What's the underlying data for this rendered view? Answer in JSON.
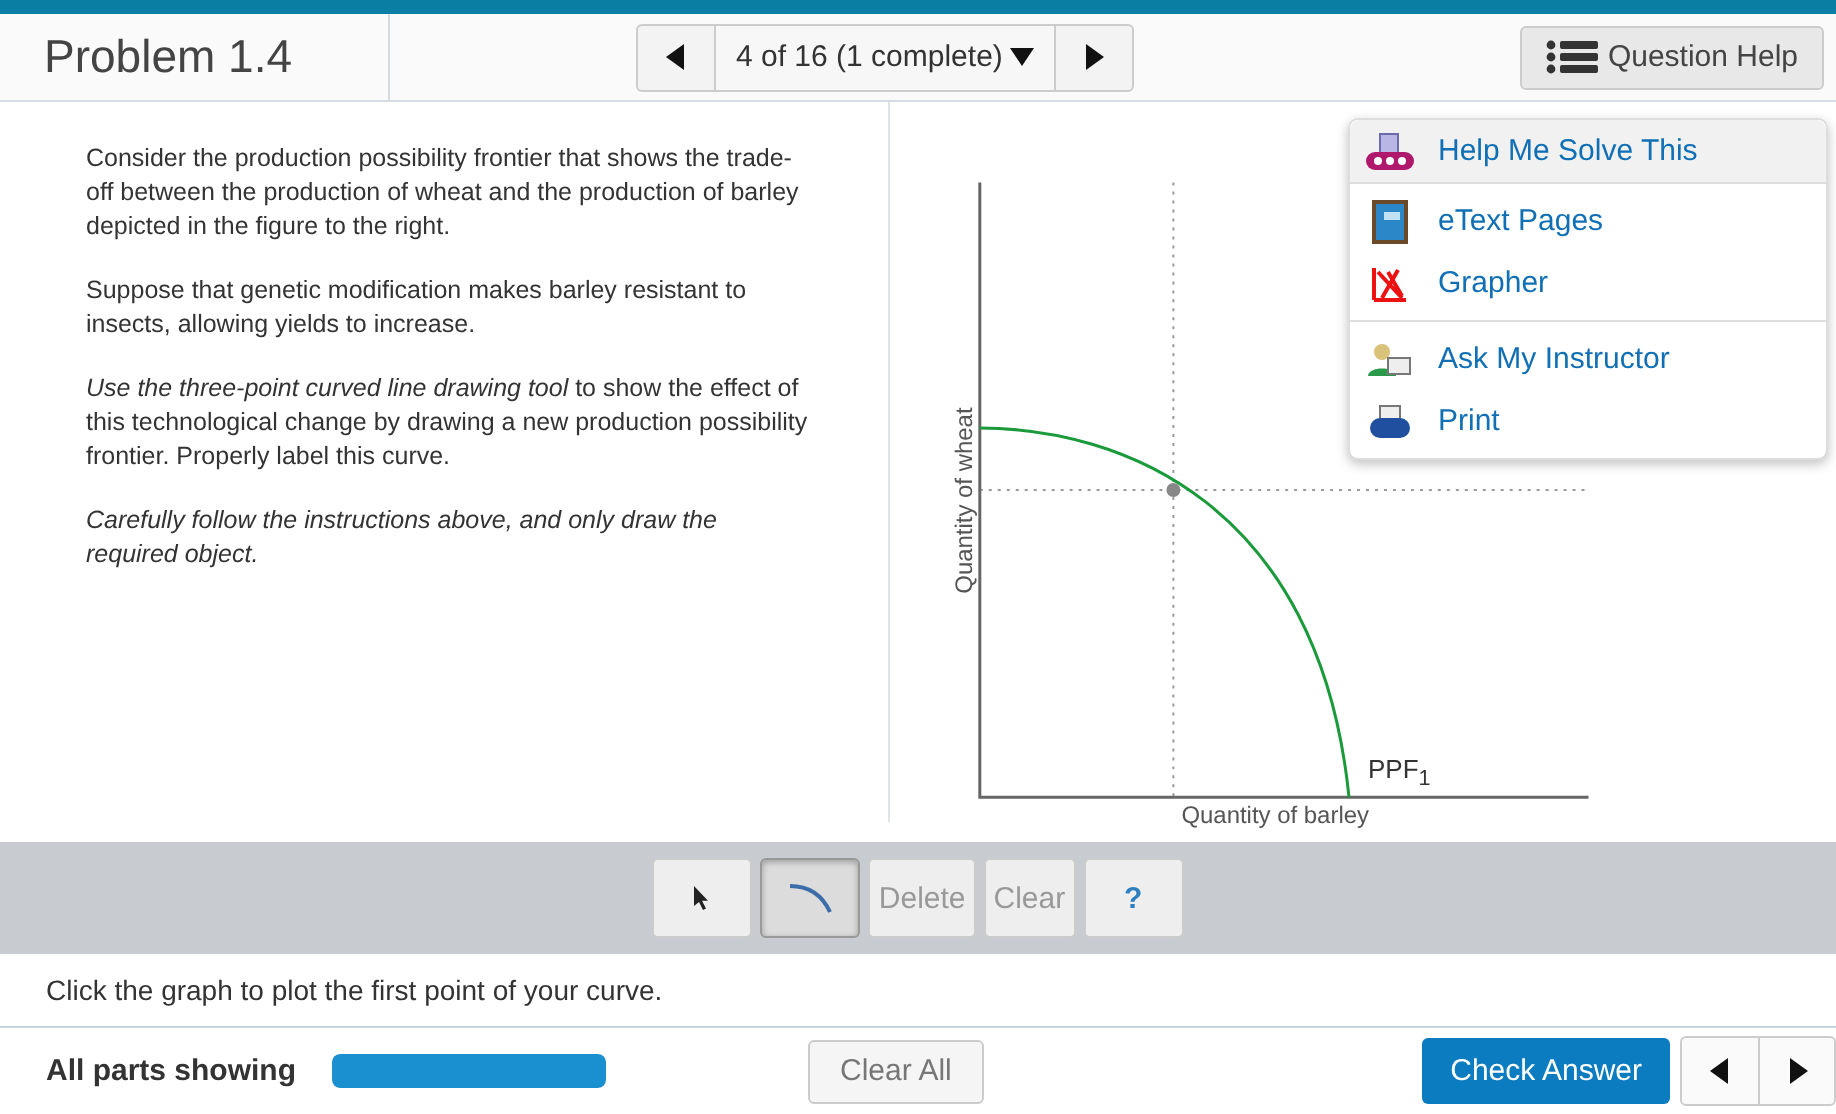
{
  "header": {
    "title": "Problem 1.4",
    "nav": {
      "position": "4 of 16 (1 complete)"
    },
    "help_button": "Question Help"
  },
  "question": [
    {
      "text": "Consider the production possibility frontier that shows the trade-off between the production of wheat and the production of barley depicted in the figure to the right.",
      "italic": false
    },
    {
      "text": "Suppose that genetic modification makes barley resistant to insects, allowing yields to increase.",
      "italic": false
    },
    {
      "text": "*Use the three-point curved line drawing tool* to show the effect of this technological change by drawing a new production possibility frontier. Properly label this curve.",
      "italic": false
    },
    {
      "text": "Carefully follow the instructions above, and only draw the required object.",
      "italic": true
    }
  ],
  "graph": {
    "ylabel": "Quantity of wheat",
    "xlabel": "Quantity of barley",
    "curve_label": "PPF$_{1}$"
  },
  "help_menu": [
    [
      {
        "kind": "solve",
        "label": "Help Me Solve This",
        "highlighted": true
      }
    ],
    [
      {
        "kind": "book",
        "label": "eText Pages",
        "highlighted": false
      },
      {
        "kind": "grapher",
        "label": "Grapher",
        "highlighted": false
      }
    ],
    [
      {
        "kind": "instructor",
        "label": "Ask My Instructor",
        "highlighted": false
      },
      {
        "kind": "print",
        "label": "Print",
        "highlighted": false
      }
    ]
  ],
  "toolbar": [
    {
      "kind": "pointer",
      "selected": false,
      "disabled": false
    },
    {
      "kind": "curve",
      "selected": true,
      "disabled": false
    },
    {
      "kind": "text",
      "label": "Delete",
      "selected": false,
      "disabled": true
    },
    {
      "kind": "text",
      "label": "Clear",
      "selected": false,
      "disabled": true
    },
    {
      "kind": "help",
      "label": "?",
      "selected": false,
      "disabled": false
    }
  ],
  "instruction": "Click the graph to plot the first point of your curve.",
  "footer": {
    "parts_label": "All parts showing",
    "progress": {
      "level": 1
    },
    "clear_all": "Clear All",
    "check_answer": "Check Answer"
  }
}
